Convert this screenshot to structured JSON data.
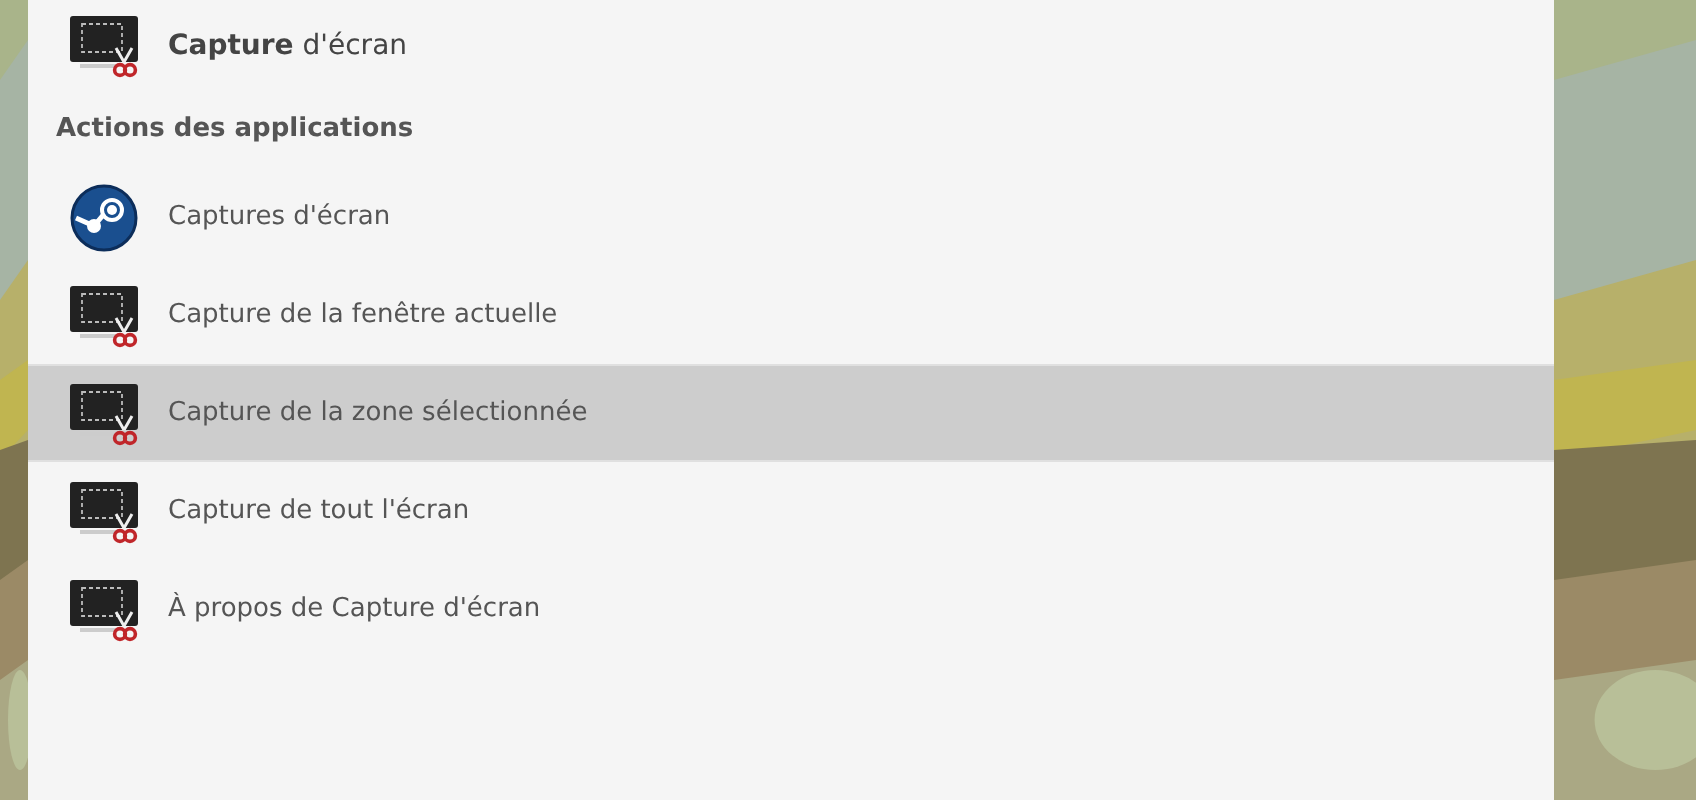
{
  "top_result": {
    "label": "**Capture** d'écran",
    "kind": "screenshot"
  },
  "section": {
    "title": "Actions des applications"
  },
  "actions": [
    {
      "label": "Captures d'écran",
      "kind": "steam",
      "selected": false
    },
    {
      "label": "Capture de la fenêtre actuelle",
      "kind": "screenshot",
      "selected": false
    },
    {
      "label": "Capture de la zone sélectionnée",
      "kind": "screenshot",
      "selected": true
    },
    {
      "label": "Capture de tout l'écran",
      "kind": "screenshot",
      "selected": false
    },
    {
      "label": "À propos de Capture d'écran",
      "kind": "screenshot",
      "selected": false
    }
  ]
}
